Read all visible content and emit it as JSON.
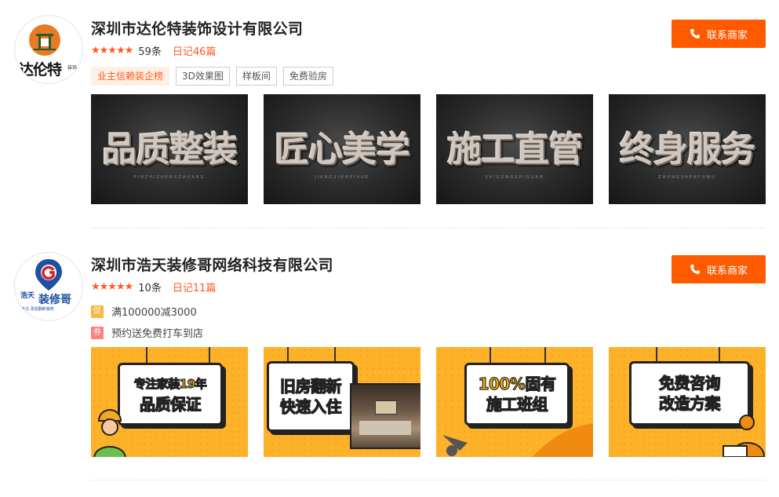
{
  "companies": [
    {
      "name": "深圳市达伦特装饰设计有限公司",
      "logo_text": "达伦特",
      "logo_side": "装饰",
      "stars": "★★★★★",
      "reviews": "59条",
      "diary": "日记46篇",
      "contact_label": "联系商家",
      "tags": [
        "业主信赖装企榜",
        "3D效果图",
        "样板间",
        "免费验房"
      ],
      "images": [
        {
          "title": "品质整装",
          "subtitle": "PINZHIZHENGZHUANG"
        },
        {
          "title": "匠心美学",
          "subtitle": "JIANGXINMEIXUE"
        },
        {
          "title": "施工直管",
          "subtitle": "SHIGONGZHIGUAN"
        },
        {
          "title": "终身服务",
          "subtitle": "ZHONGSHENFUWU"
        }
      ]
    },
    {
      "name": "深圳市浩天装修哥网络科技有限公司",
      "logo_text": "装修哥",
      "logo_brand": "浩天",
      "logo_sub": "专注 改造翻新装修",
      "stars": "★★★★★",
      "reviews": "10条",
      "diary": "日记11篇",
      "contact_label": "联系商家",
      "promos": [
        {
          "badge": "促",
          "text": "满100000减3000"
        },
        {
          "badge": "券",
          "text": "预约送免费打车到店"
        }
      ],
      "images": [
        {
          "line1": "专注家装19年",
          "line2": "品质保证"
        },
        {
          "line1": "旧房翻新",
          "line2": "快速入住"
        },
        {
          "line1": "100%固有",
          "line2": "施工班组"
        },
        {
          "line1": "免费咨询",
          "line2": "改造方案"
        }
      ]
    }
  ],
  "colors": {
    "accent": "#ff5a00",
    "star": "#ff5a1f",
    "yellow": "#fdb22a"
  }
}
